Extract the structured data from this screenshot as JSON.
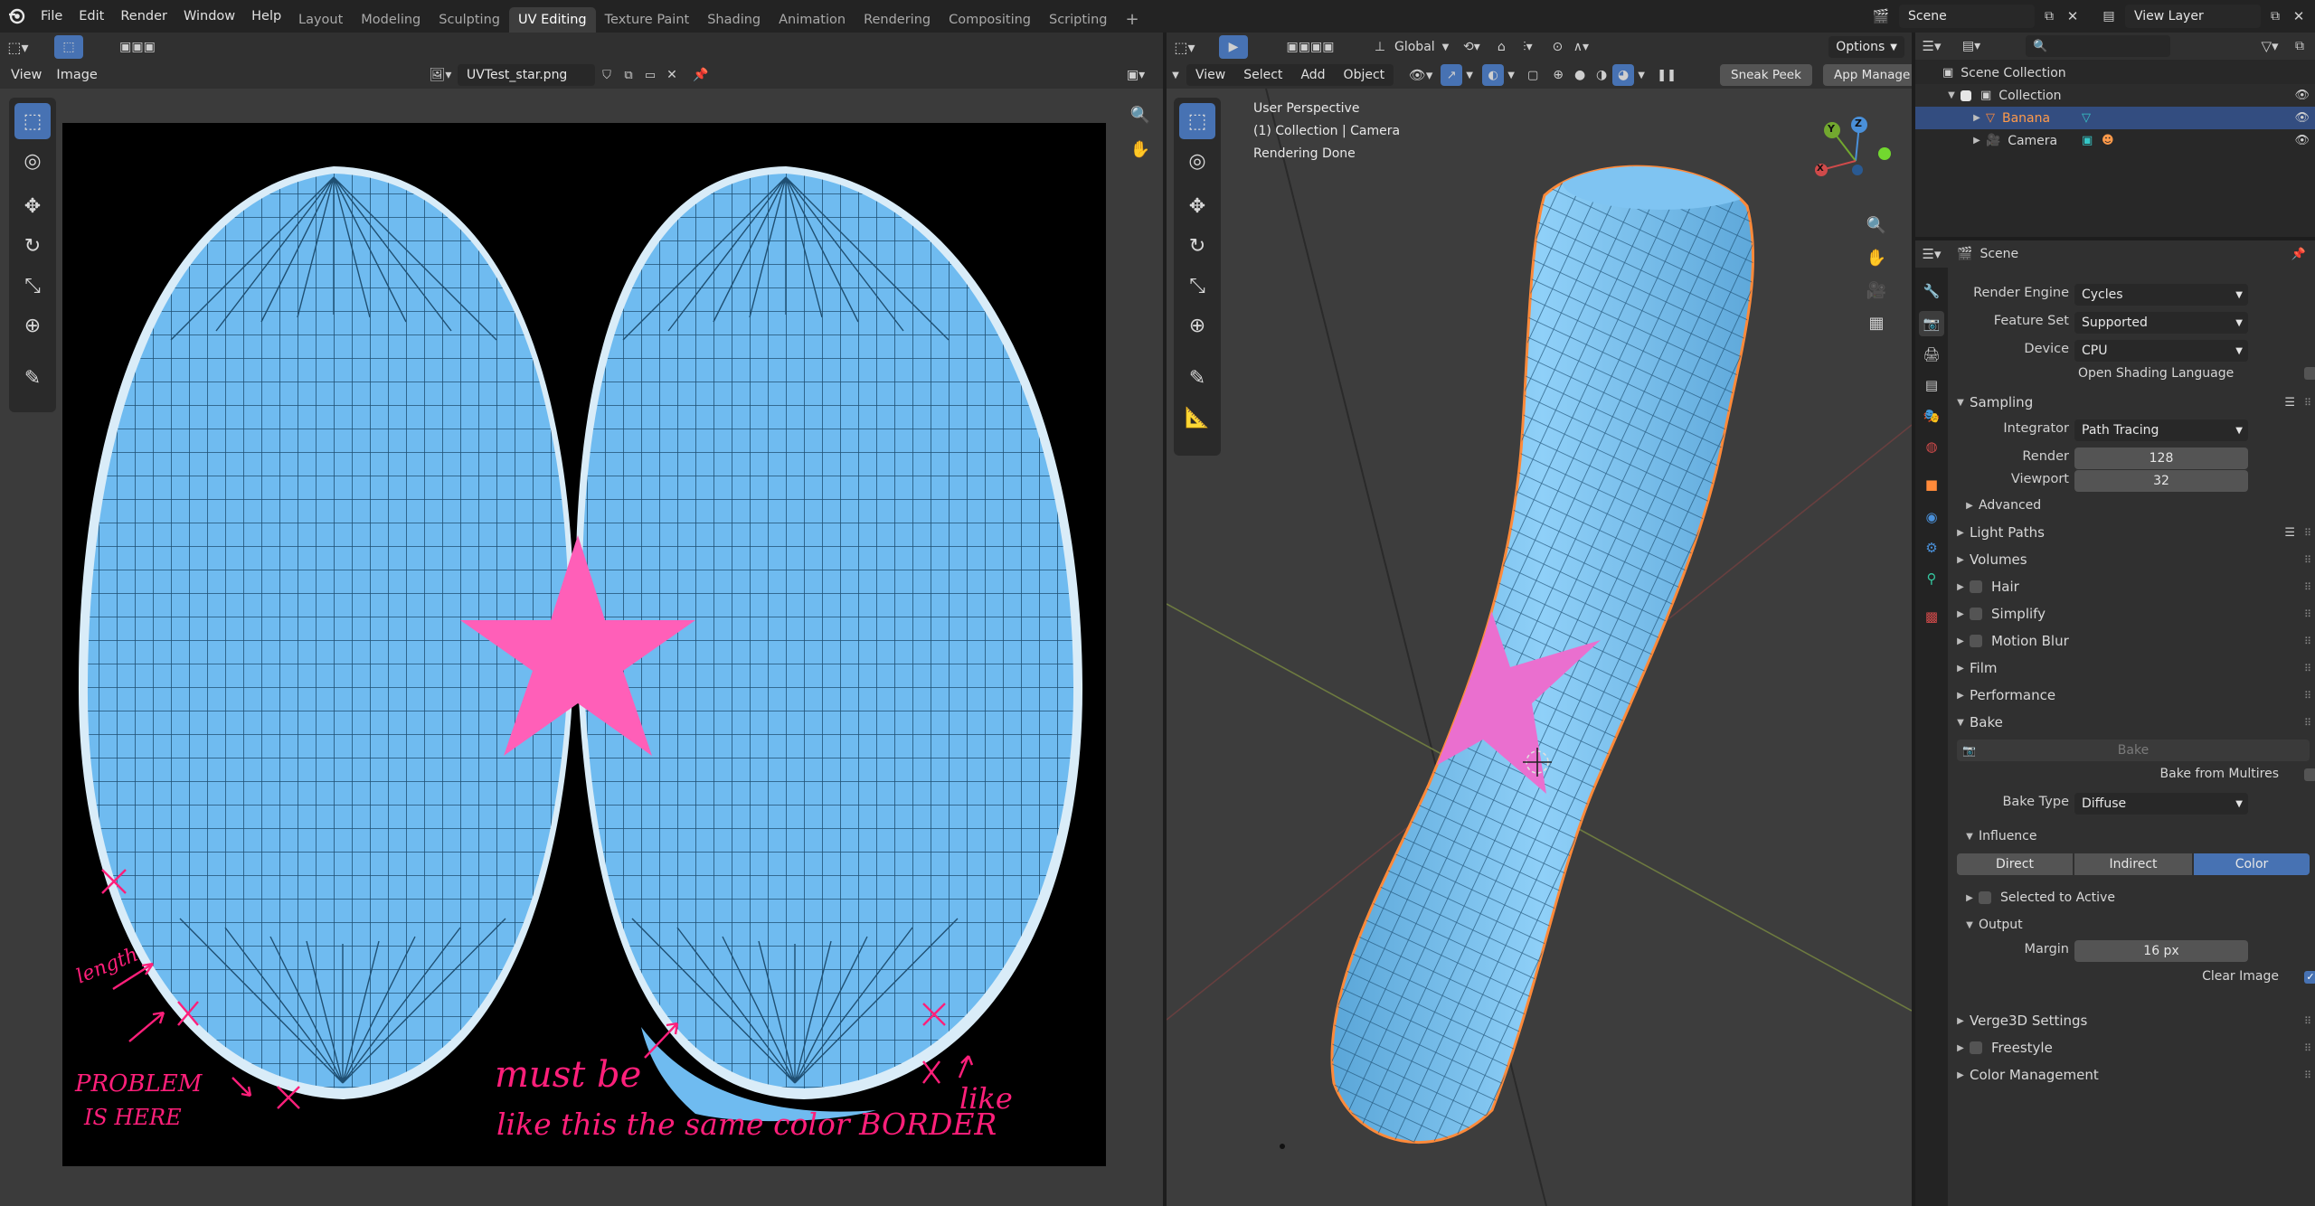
{
  "topbar": {
    "menus": [
      "File",
      "Edit",
      "Render",
      "Window",
      "Help"
    ],
    "workspace_tabs": [
      "Layout",
      "Modeling",
      "Sculpting",
      "UV Editing",
      "Texture Paint",
      "Shading",
      "Animation",
      "Rendering",
      "Compositing",
      "Scripting"
    ],
    "active_tab": "UV Editing",
    "add_tab": "+",
    "scene_name": "Scene",
    "view_layer_name": "View Layer"
  },
  "uv_editor": {
    "menus": [
      "View",
      "Image"
    ],
    "image_name": "UVTest_star.png"
  },
  "viewport": {
    "menus": [
      "View",
      "Select",
      "Add",
      "Object"
    ],
    "transform_orientation": "Global",
    "options_label": "Options",
    "sneak_peek_label": "Sneak Peek",
    "app_manager_label": "App Manage",
    "overlay_text": [
      "User Perspective",
      "(1) Collection | Camera",
      "Rendering Done"
    ],
    "gizmo_axes": [
      "Z",
      "Y",
      "X"
    ]
  },
  "outliner": {
    "items": [
      {
        "label": "Scene Collection"
      },
      {
        "label": "Collection"
      },
      {
        "label": "Banana"
      },
      {
        "label": "Camera"
      }
    ]
  },
  "properties": {
    "context_title": "Scene",
    "render_engine": {
      "label": "Render Engine",
      "value": "Cycles"
    },
    "feature_set": {
      "label": "Feature Set",
      "value": "Supported"
    },
    "device": {
      "label": "Device",
      "value": "CPU"
    },
    "osl": {
      "label": "Open Shading Language"
    },
    "sampling": {
      "title": "Sampling",
      "integrator_label": "Integrator",
      "integrator": "Path Tracing",
      "render_label": "Render",
      "render": "128",
      "viewport_label": "Viewport",
      "viewport": "32",
      "advanced": "Advanced"
    },
    "panels_a": [
      "Light Paths",
      "Volumes"
    ],
    "hair": "Hair",
    "simplify": "Simplify",
    "motion_blur": "Motion Blur",
    "panels_b": [
      "Film",
      "Performance"
    ],
    "bake": {
      "title": "Bake",
      "bake_button": "Bake",
      "bake_from_multires": "Bake from Multires",
      "bake_type_label": "Bake Type",
      "bake_type": "Diffuse",
      "influence": "Influence",
      "influence_buttons": [
        "Direct",
        "Indirect",
        "Color"
      ],
      "influence_active": "Color",
      "selected_to_active": "Selected to Active",
      "output": "Output",
      "margin_label": "Margin",
      "margin": "16 px",
      "clear_image": "Clear Image"
    },
    "verge3d": "Verge3D Settings",
    "freestyle": "Freestyle",
    "color_management": "Color Management"
  },
  "annotations": {
    "length": "length",
    "problem": "PROBLEM",
    "is_here": "IS HERE",
    "must_be": "must be",
    "like_this": "like this the same color BORDER",
    "like": "like"
  },
  "colors": {
    "uv_blue": "#6fbbf0",
    "star_pink": "#ff5fb8",
    "annotation_red": "#ff1f7a",
    "accent_blue": "#4772b3",
    "selected_object": "#ff8a3a"
  }
}
